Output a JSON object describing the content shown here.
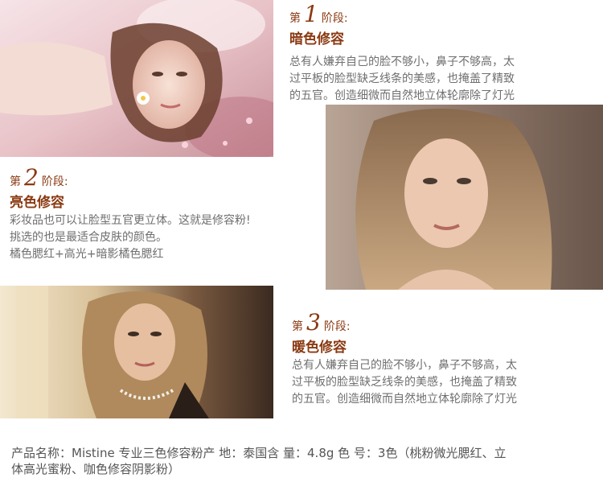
{
  "stages": [
    {
      "prefix": "第",
      "num": "1",
      "suffix": "阶段:",
      "title": "暗色修容",
      "lines": [
        "总有人嫌弃自己的脸不够小，鼻子不够高，太",
        "过平板的脸型缺乏线条的美感，也掩盖了精致",
        "的五官。创造细微而自然地立体轮廓除了灯光"
      ]
    },
    {
      "prefix": "第",
      "num": "2",
      "suffix": "阶段:",
      "title": "亮色修容",
      "lines": [
        "彩妆品也可以让脸型五官更立体。这就是修容粉!",
        "挑选的也是最适合皮肤的颜色。",
        "橘色腮红+高光+暗影橘色腮红"
      ]
    },
    {
      "prefix": "第",
      "num": "3",
      "suffix": "阶段:",
      "title": "暖色修容",
      "lines": [
        "总有人嫌弃自己的脸不够小，鼻子不够高，太",
        "过平板的脸型缺乏线条的美感，也掩盖了精致",
        "的五官。创造细微而自然地立体轮廓除了灯光"
      ]
    }
  ],
  "footer": {
    "line1": "产品名称：Mistine 专业三色修容粉产 地：泰国含 量：4.8g 色 号：3色（桃粉微光腮红、立",
    "line2": "体高光蜜粉、咖色修容阴影粉）"
  },
  "colors": {
    "accent": "#8a3a12",
    "body_text": "#6f6f6f"
  }
}
